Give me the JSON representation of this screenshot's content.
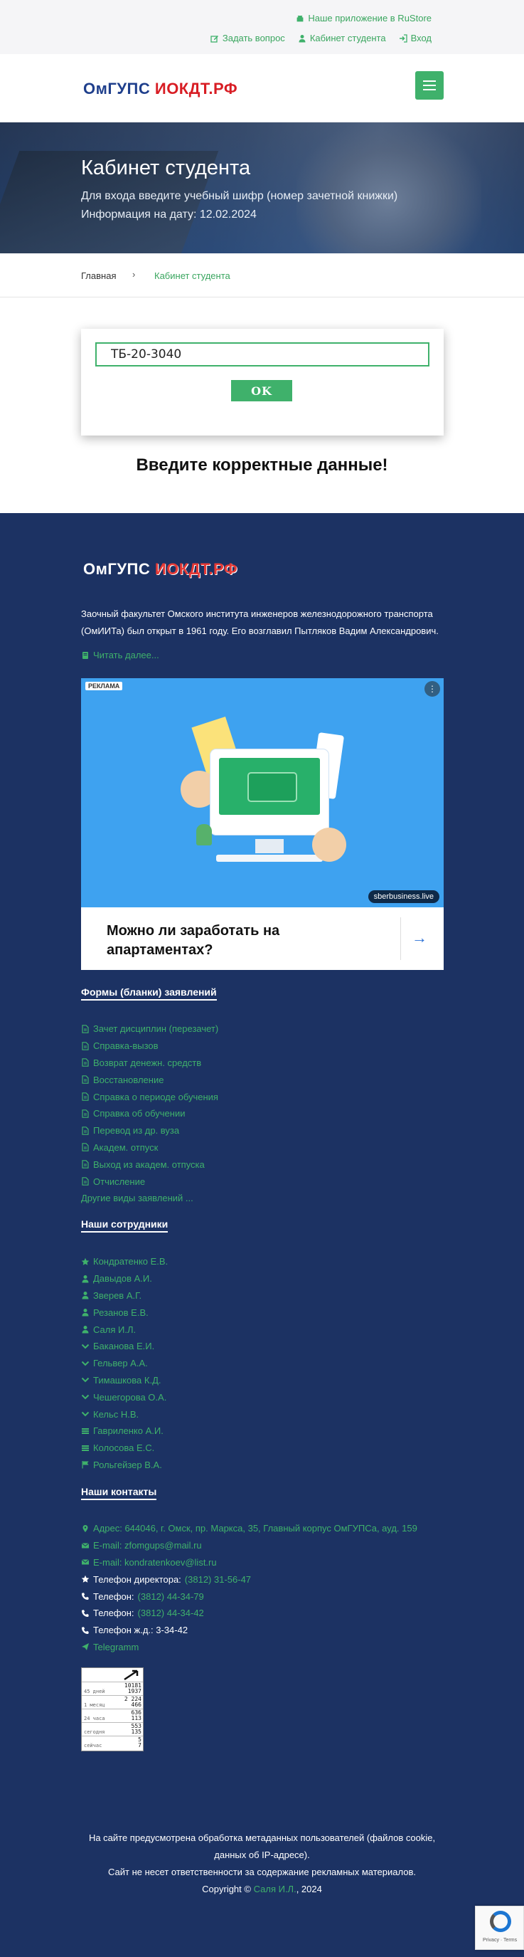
{
  "topbar": {
    "app_link": "Наше приложение в RuStore",
    "ask_question": "Задать вопрос",
    "student_cabinet": "Кабинет студента",
    "login": "Вход"
  },
  "header": {
    "logo_part1": "ОмГУПС",
    "logo_part2": "ИОКДТ.РФ"
  },
  "hero": {
    "title": "Кабинет студента",
    "subtitle": "Для входа введите учебный шифр (номер зачетной книжки)",
    "info_date": "Информация на дату: 12.02.2024"
  },
  "breadcrumb": {
    "home": "Главная",
    "separator": "›",
    "current": "Кабинет студента"
  },
  "login": {
    "cipher_value": "ТБ-20-3040",
    "ok_label": "OK",
    "error_message": "Введите корректные данные!"
  },
  "footer": {
    "about": "Заочный факультет Омского института инженеров железнодорожного транспорта (ОмИИТа) был открыт в 1961 году. Его возглавил Пытляков Вадим Александрович.",
    "read_more": "Читать далее...",
    "ad": {
      "tag": "РЕКЛАМА",
      "menu": "⋮",
      "brand": "sberbusiness.live",
      "caption": "Можно ли заработать на апартаментах?",
      "arrow": "→"
    },
    "forms_title": "Формы (бланки) заявлений",
    "forms": [
      "Зачет дисциплин (перезачет)",
      "Справка-вызов",
      "Возврат денежн. средств",
      "Восстановление",
      "Справка о периоде обучения",
      "Справка об обучении",
      "Перевод из др. вуза",
      "Академ. отпуск",
      "Выход из академ. отпуска",
      "Отчисление"
    ],
    "forms_other": "Другие виды заявлений ...",
    "staff_title": "Наши сотрудники",
    "staff": [
      {
        "icon": "star-icon",
        "name": "Кондратенко Е.В."
      },
      {
        "icon": "user-icon",
        "name": "Давыдов А.И."
      },
      {
        "icon": "user-icon",
        "name": "Зверев А.Г."
      },
      {
        "icon": "user-icon",
        "name": "Резанов Е.В."
      },
      {
        "icon": "user-icon",
        "name": "Саля И.Л."
      },
      {
        "icon": "chevron-down-icon",
        "name": "Баканова Е.И."
      },
      {
        "icon": "chevron-down-icon",
        "name": "Гельвер А.А."
      },
      {
        "icon": "chevron-down-icon",
        "name": "Тимашкова К.Д."
      },
      {
        "icon": "chevron-down-icon",
        "name": "Чешегорова О.А."
      },
      {
        "icon": "chevron-down-icon",
        "name": "Кельс Н.В."
      },
      {
        "icon": "list-icon",
        "name": "Гавриленко А.И."
      },
      {
        "icon": "list-icon",
        "name": "Колосова Е.С."
      },
      {
        "icon": "flag-icon",
        "name": "Рольгейзер В.А."
      }
    ],
    "contacts_title": "Наши контакты",
    "contacts": {
      "address": "Адрес: 644046, г. Омск, пр. Маркса, 35, Главный корпус ОмГУПСа, ауд. 159",
      "email1": "E-mail: zfomgups@mail.ru",
      "email2": "E-mail: kondratenkoev@list.ru",
      "director_phone_label": "Телефон директора:",
      "director_phone": "(3812) 31-56-47",
      "phone_label": "Телефон:",
      "phone1": "(3812) 44-34-79",
      "phone2": "(3812) 44-34-42",
      "rail_phone": "Телефон ж.д.: 3-34-42",
      "telegram": "Telegramm"
    },
    "counter": {
      "rows": [
        {
          "label": "45 дней",
          "a": "10181",
          "b": "1937"
        },
        {
          "label": "1 месяц",
          "a": "2 224",
          "b": "466"
        },
        {
          "label": "24 часа",
          "a": "636",
          "b": "113"
        },
        {
          "label": "сегодня",
          "a": "553",
          "b": "135"
        },
        {
          "label": "сейчас",
          "a": "5",
          "b": "7"
        }
      ]
    },
    "legal_line1": "На сайте предусмотрена обработка метаданных пользователей (файлов cookie, данных об IP-адресе).",
    "legal_line2": "Сайт не несет ответственности за содержание рекламных материалов.",
    "copyright_prefix": "Copyright ©",
    "copyright_author": "Саля И.Л.",
    "copyright_year": ", 2024"
  },
  "recaptcha": {
    "privacy_terms": "Privacy · Terms"
  },
  "colors": {
    "accent_green": "#3fb16b",
    "footer_navy": "#1c3263",
    "logo_blue": "#1f3f8c",
    "logo_red": "#d81d24"
  }
}
